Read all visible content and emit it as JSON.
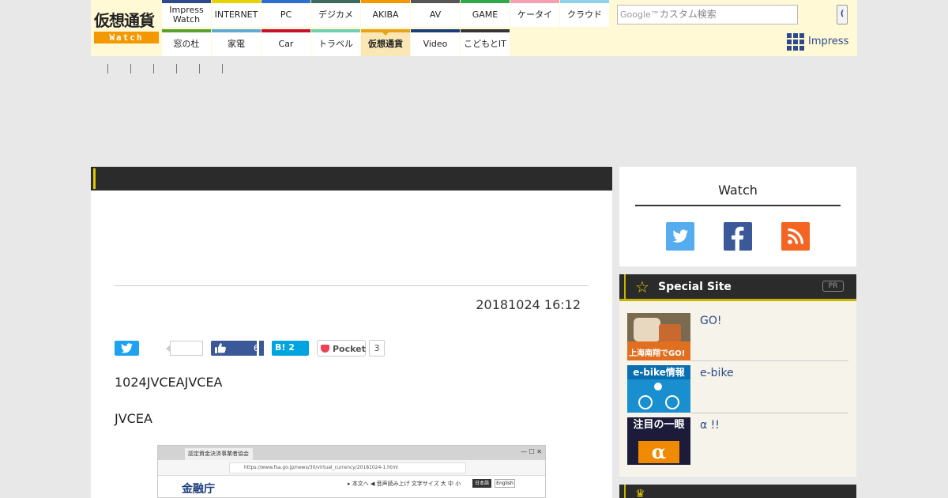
{
  "logo": {
    "top_text": "仮想通貨",
    "bottom_text": "Watch"
  },
  "nav": {
    "row1": [
      {
        "label": "Impress Watch",
        "color": "#2e4a8a"
      },
      {
        "label": "INTERNET",
        "color": "#e6d300"
      },
      {
        "label": "PC",
        "color": "#2d6fd0"
      },
      {
        "label": "デジカメ",
        "color": "#3d6b5e"
      },
      {
        "label": "AKIBA",
        "color": "#f39800"
      },
      {
        "label": "AV",
        "color": "#555555"
      },
      {
        "label": "GAME",
        "color": "#2ea84a"
      },
      {
        "label": "ケータイ",
        "color": "#f4a0b0"
      },
      {
        "label": "クラウド",
        "color": "#8fd0ea"
      }
    ],
    "row2": [
      {
        "label": "窓の杜",
        "color": "#5aa032"
      },
      {
        "label": "家電",
        "color": "#5fa8d8"
      },
      {
        "label": "Car",
        "color": "#c8102e"
      },
      {
        "label": "トラベル",
        "color": "#6fcfb0"
      },
      {
        "label": "仮想通貨",
        "color": "#e6a31b",
        "active": true
      },
      {
        "label": "Video",
        "color": "#1a3d7c"
      },
      {
        "label": "こどもとIT",
        "color": "#333333"
      }
    ]
  },
  "search": {
    "brand": "Google™",
    "placeholder": "カスタム検索",
    "button_label": "("
  },
  "impress_brand": "Impress",
  "article": {
    "date": "20181024 16:12",
    "paragraph1": "1024JVCEAJVCEA",
    "paragraph2": "JVCEA",
    "share": {
      "facebook_count": "6",
      "hatena_label": "B!",
      "hatena_count": "2",
      "pocket_label": "Pocket",
      "pocket_count": "3"
    },
    "figure": {
      "tab_title": "認定資金決済事業者協会",
      "url": "https://www.fsa.go.jp/news/30/virtual_currency/20181024-1.html",
      "logo_text": "金融庁",
      "nav_text": "▸ 本文へ    ◀ 音声読み上げ     文字サイズ  大  中  小",
      "lang_ja": "日本語",
      "lang_en": "English",
      "window_buttons": "—  ☐  ✕"
    }
  },
  "sidebar": {
    "watch_title": "Watch",
    "special": {
      "title": "Special Site",
      "badge": "PR",
      "items": [
        {
          "label": "GO!",
          "thumb_text": "上海南翔でGO!"
        },
        {
          "label": "e-bike",
          "thumb_text": "e-bike情報"
        },
        {
          "label": "α !!",
          "thumb_text": "注目の一眼",
          "thumb_alpha": "α"
        }
      ]
    }
  }
}
